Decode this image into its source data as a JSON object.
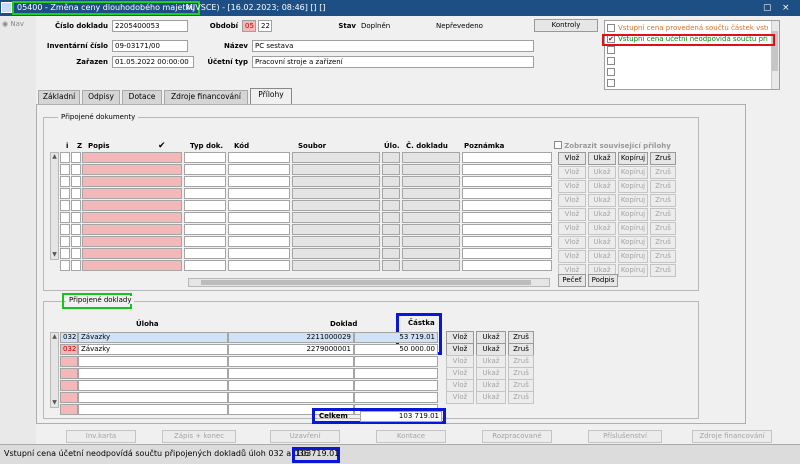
{
  "window": {
    "title_main": "05400 - Změna ceny dlouhodobého majetku",
    "title_rest": "MJVSCE) - [16.02.2023; 08:46] [] []",
    "restore_glyph": "▢",
    "close_glyph": "×"
  },
  "left_strip": {
    "nav_label": "Nav"
  },
  "header": {
    "cislo_dokladu_label": "Číslo dokladu",
    "cislo_dokladu_value": "2205400053",
    "obdobi_label": "Období",
    "obdobi_month": "05",
    "obdobi_year": "22",
    "stav_label": "Stav",
    "stav_value": "Doplněn",
    "prevod_value": "Nepřevedeno",
    "kontroly_button": "Kontroly",
    "inventarni_cislo_label": "Inventární číslo",
    "inventarni_cislo_value": "09-03171/00",
    "nazev_label": "Název",
    "nazev_value": "PC sestava",
    "zarazen_label": "Zařazen",
    "zarazen_value": "01.05.2022 00:00:00",
    "ucetni_typ_label": "Účetní typ",
    "ucetni_typ_value": "Pracovní stroje a zařízení"
  },
  "alerts": [
    {
      "text": "Vstupní cena provedená součtu částek vstu",
      "checked": false,
      "color": "#e07020"
    },
    {
      "text": "Vstupní cena účetní neodpovídá součtu připoj",
      "checked": true,
      "color": "#0a8a0a"
    }
  ],
  "tabs": [
    "Základní",
    "Odpisy",
    "Dotace",
    "Zdroje financování",
    "Přílohy"
  ],
  "active_tab": "Přílohy",
  "prilohy": {
    "group_title": "Připojené dokumenty",
    "columns": {
      "i": "i",
      "z": "Z",
      "popis": "Popis",
      "check": "✔",
      "typ": "Typ dok.",
      "kod": "Kód",
      "soubor": "Soubor",
      "ulo": "Úlo.",
      "cdokladu": "Č. dokladu",
      "poznamka": "Poznámka"
    },
    "show_related_label": "Zobrazit související přílohy",
    "row_buttons": [
      "Vlož",
      "Ukaž",
      "Kopíruj",
      "Zruš"
    ],
    "pecet_button": "Pečeť",
    "podpis_button": "Podpis"
  },
  "doklady": {
    "group_title": "Připojené doklady",
    "col_uloha": "Úloha",
    "col_doklad": "Doklad",
    "col_castka": "Částka",
    "rows": [
      {
        "kod": "032",
        "uloha": "Závazky",
        "doklad": "2211000029",
        "castka": "53 719.01"
      },
      {
        "kod": "032",
        "uloha": "Závazky",
        "doklad": "2279000001",
        "castka": "50 000.00"
      }
    ],
    "row_buttons": [
      "Vlož",
      "Ukaž",
      "Zruš"
    ],
    "celkem_label": "Celkem",
    "celkem_value": "103 719.01"
  },
  "bottom_buttons": [
    "Inv.karta",
    "Zápis + konec",
    "Uzavření",
    "Kontace",
    "Rozpracované",
    "Příslušenství",
    "Zdroje financování"
  ],
  "status": {
    "message": "Vstupní cena účetní neodpovídá součtu připojených dokladů úloh 032 a 036",
    "value": "103719.01"
  },
  "colors": {
    "titlebar": "#1e4f84",
    "highlight_green": "#18c41c",
    "highlight_red": "#e0101a",
    "highlight_blue": "#0a17d8",
    "pink_cell": "#f4b8b8",
    "selected_cell": "#cfe2f7"
  }
}
